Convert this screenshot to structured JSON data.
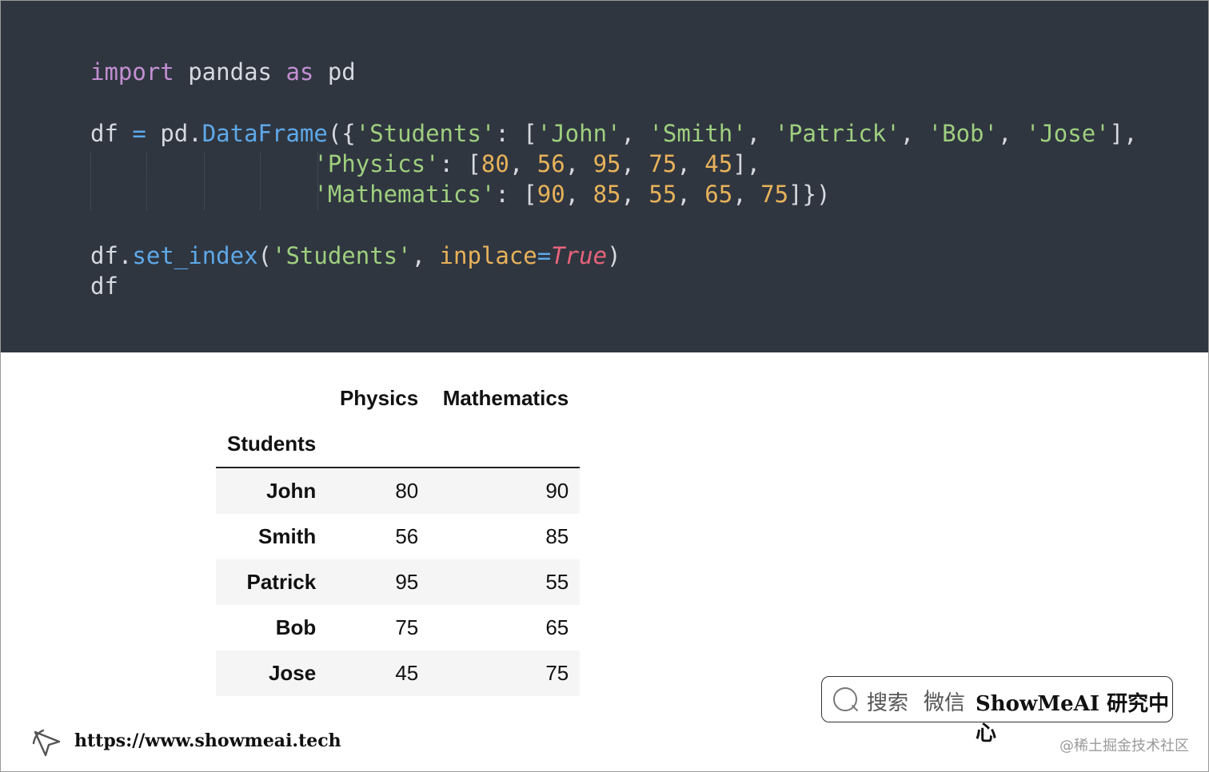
{
  "code": {
    "lines": [
      [
        {
          "t": "import",
          "c": "kw"
        },
        {
          "t": " pandas ",
          "c": ""
        },
        {
          "t": "as",
          "c": "kw"
        },
        {
          "t": " pd",
          "c": ""
        }
      ],
      [],
      [
        {
          "t": "df ",
          "c": ""
        },
        {
          "t": "=",
          "c": "op"
        },
        {
          "t": " pd.",
          "c": ""
        },
        {
          "t": "DataFrame",
          "c": "fn"
        },
        {
          "t": "({",
          "c": ""
        },
        {
          "t": "'Students'",
          "c": "str"
        },
        {
          "t": ": [",
          "c": ""
        },
        {
          "t": "'John'",
          "c": "str"
        },
        {
          "t": ", ",
          "c": ""
        },
        {
          "t": "'Smith'",
          "c": "str"
        },
        {
          "t": ", ",
          "c": ""
        },
        {
          "t": "'Patrick'",
          "c": "str"
        },
        {
          "t": ", ",
          "c": ""
        },
        {
          "t": "'Bob'",
          "c": "str"
        },
        {
          "t": ", ",
          "c": ""
        },
        {
          "t": "'Jose'",
          "c": "str"
        },
        {
          "t": "],",
          "c": ""
        }
      ],
      [
        {
          "t": "                ",
          "c": ""
        },
        {
          "t": "'Physics'",
          "c": "str"
        },
        {
          "t": ": [",
          "c": ""
        },
        {
          "t": "80",
          "c": "num"
        },
        {
          "t": ", ",
          "c": ""
        },
        {
          "t": "56",
          "c": "num"
        },
        {
          "t": ", ",
          "c": ""
        },
        {
          "t": "95",
          "c": "num"
        },
        {
          "t": ", ",
          "c": ""
        },
        {
          "t": "75",
          "c": "num"
        },
        {
          "t": ", ",
          "c": ""
        },
        {
          "t": "45",
          "c": "num"
        },
        {
          "t": "],",
          "c": ""
        }
      ],
      [
        {
          "t": "                ",
          "c": ""
        },
        {
          "t": "'Mathematics'",
          "c": "str"
        },
        {
          "t": ": [",
          "c": ""
        },
        {
          "t": "90",
          "c": "num"
        },
        {
          "t": ", ",
          "c": ""
        },
        {
          "t": "85",
          "c": "num"
        },
        {
          "t": ", ",
          "c": ""
        },
        {
          "t": "55",
          "c": "num"
        },
        {
          "t": ", ",
          "c": ""
        },
        {
          "t": "65",
          "c": "num"
        },
        {
          "t": ", ",
          "c": ""
        },
        {
          "t": "75",
          "c": "num"
        },
        {
          "t": "]})",
          "c": ""
        }
      ],
      [],
      [
        {
          "t": "df.",
          "c": ""
        },
        {
          "t": "set_index",
          "c": "fn"
        },
        {
          "t": "(",
          "c": ""
        },
        {
          "t": "'Students'",
          "c": "str"
        },
        {
          "t": ", ",
          "c": ""
        },
        {
          "t": "inplace",
          "c": "param"
        },
        {
          "t": "=",
          "c": "op"
        },
        {
          "t": "True",
          "c": "bool"
        },
        {
          "t": ")",
          "c": ""
        }
      ],
      [
        {
          "t": "df",
          "c": ""
        }
      ]
    ]
  },
  "table": {
    "columns": [
      "Physics",
      "Mathematics"
    ],
    "index_name": "Students",
    "rows": [
      {
        "name": "John",
        "physics": "80",
        "math": "90"
      },
      {
        "name": "Smith",
        "physics": "56",
        "math": "85"
      },
      {
        "name": "Patrick",
        "physics": "95",
        "math": "55"
      },
      {
        "name": "Bob",
        "physics": "75",
        "math": "65"
      },
      {
        "name": "Jose",
        "physics": "45",
        "math": "75"
      }
    ]
  },
  "badge": {
    "search_label": "搜索",
    "wechat_label": "微信",
    "brand": "ShowMeAI 研究中心",
    "icon": "search-icon"
  },
  "footer": {
    "url": "https://www.showmeai.tech",
    "icon": "cursor-arrow-icon",
    "credit": "@稀土掘金技术社区"
  },
  "colors": {
    "code_bg": "#2f3640",
    "keyword": "#c38fd2",
    "function": "#5ea8e8",
    "string": "#9fcf7e",
    "number": "#e8b25a",
    "boolean": "#e8637b"
  }
}
